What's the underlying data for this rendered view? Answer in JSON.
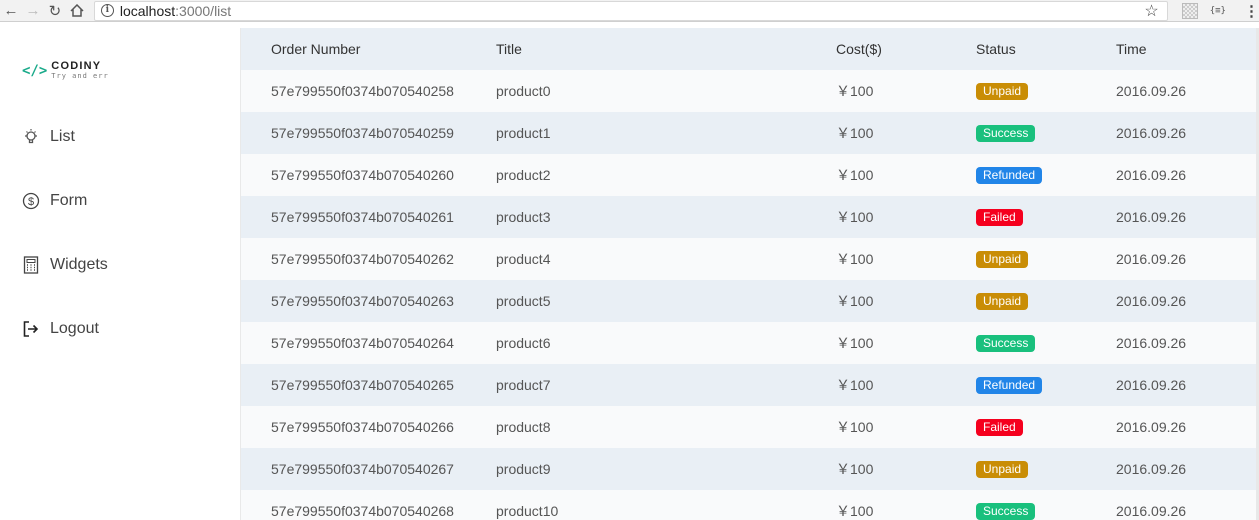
{
  "browser": {
    "url_host": "localhost",
    "url_path": ":3000/list"
  },
  "sidebar": {
    "logo_title": "CODINY",
    "logo_subtitle": "Try and err",
    "items": [
      {
        "label": "List",
        "icon": "bulb-icon"
      },
      {
        "label": "Form",
        "icon": "dollar-icon"
      },
      {
        "label": "Widgets",
        "icon": "calculator-icon"
      },
      {
        "label": "Logout",
        "icon": "logout-icon"
      }
    ]
  },
  "table": {
    "headers": {
      "order": "Order Number",
      "title": "Title",
      "cost": "Cost($)",
      "status": "Status",
      "time": "Time"
    },
    "status_colors": {
      "Unpaid": "#c98d06",
      "Success": "#19c07d",
      "Refunded": "#2185e8",
      "Failed": "#f5001e"
    },
    "rows": [
      {
        "order": "57e799550f0374b070540258",
        "title": "product0",
        "cost": "￥100",
        "status": "Unpaid",
        "time": "2016.09.26"
      },
      {
        "order": "57e799550f0374b070540259",
        "title": "product1",
        "cost": "￥100",
        "status": "Success",
        "time": "2016.09.26"
      },
      {
        "order": "57e799550f0374b070540260",
        "title": "product2",
        "cost": "￥100",
        "status": "Refunded",
        "time": "2016.09.26"
      },
      {
        "order": "57e799550f0374b070540261",
        "title": "product3",
        "cost": "￥100",
        "status": "Failed",
        "time": "2016.09.26"
      },
      {
        "order": "57e799550f0374b070540262",
        "title": "product4",
        "cost": "￥100",
        "status": "Unpaid",
        "time": "2016.09.26"
      },
      {
        "order": "57e799550f0374b070540263",
        "title": "product5",
        "cost": "￥100",
        "status": "Unpaid",
        "time": "2016.09.26"
      },
      {
        "order": "57e799550f0374b070540264",
        "title": "product6",
        "cost": "￥100",
        "status": "Success",
        "time": "2016.09.26"
      },
      {
        "order": "57e799550f0374b070540265",
        "title": "product7",
        "cost": "￥100",
        "status": "Refunded",
        "time": "2016.09.26"
      },
      {
        "order": "57e799550f0374b070540266",
        "title": "product8",
        "cost": "￥100",
        "status": "Failed",
        "time": "2016.09.26"
      },
      {
        "order": "57e799550f0374b070540267",
        "title": "product9",
        "cost": "￥100",
        "status": "Unpaid",
        "time": "2016.09.26"
      },
      {
        "order": "57e799550f0374b070540268",
        "title": "product10",
        "cost": "￥100",
        "status": "Success",
        "time": "2016.09.26"
      }
    ]
  }
}
